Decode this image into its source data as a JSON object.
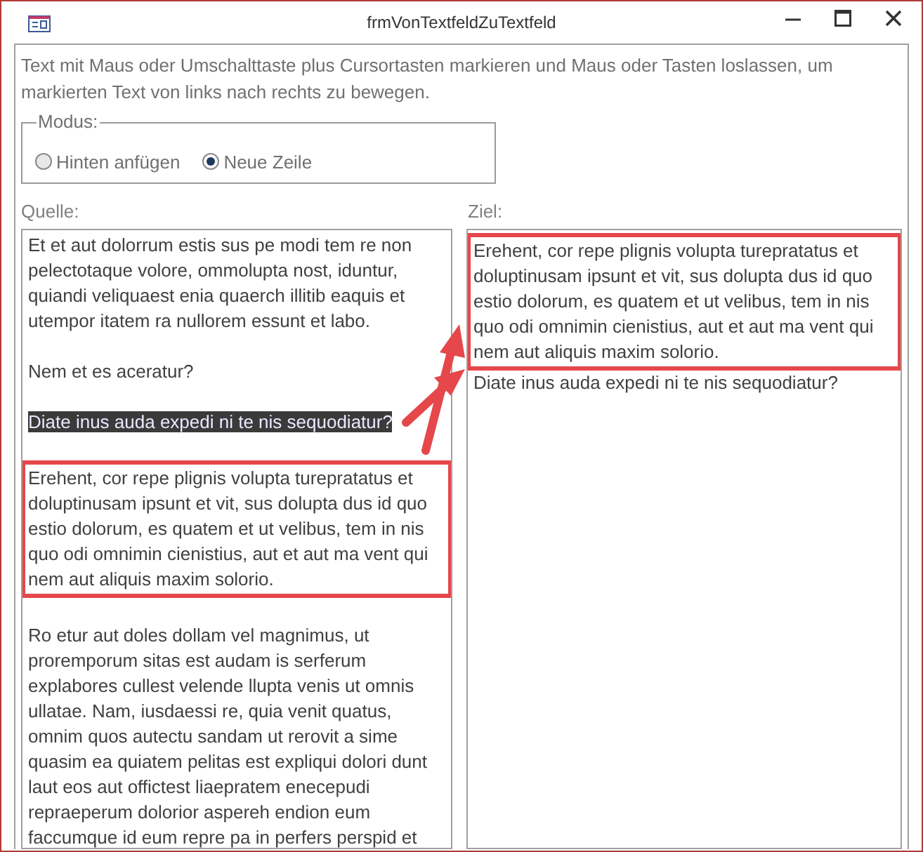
{
  "window": {
    "title": "frmVonTextfeldZuTextfeld"
  },
  "instruction": "Text mit Maus oder Umschalttaste plus Cursortasten markieren und Maus oder Tasten loslassen, um markierten Text von links nach rechts zu bewegen.",
  "modus": {
    "label": "Modus:",
    "options": [
      {
        "label": "Hinten anfügen",
        "selected": false
      },
      {
        "label": "Neue Zeile",
        "selected": true
      }
    ]
  },
  "source": {
    "label": "Quelle:",
    "paragraphs": [
      {
        "text": "Et et aut dolorrum estis sus pe modi tem re non pelectotaque volore, ommolupta nost, iduntur, quiandi veliquaest enia quaerch illitib eaquis et utempor itatem ra nullorem essunt et labo.",
        "selected": false,
        "framed": false
      },
      {
        "text": "Nem et es aceratur?",
        "selected": false,
        "framed": false
      },
      {
        "text": "Diate inus auda expedi ni te nis sequodiatur?",
        "selected": true,
        "framed": false
      },
      {
        "text": "Erehent, cor repe plignis volupta turepratatus et doluptinusam ipsunt et vit, sus dolupta dus id quo estio dolorum, es quatem et ut velibus, tem in nis quo odi omnimin cienistius, aut et aut ma vent qui nem aut aliquis maxim solorio.",
        "selected": false,
        "framed": true
      },
      {
        "text": "Ro etur aut doles dollam vel magnimus, ut proremporum sitas est audam is serferum explabores cullest velende llupta venis ut omnis ullatae. Nam, iusdaessi re, quia venit quatus, omnim quos autectu sandam ut rerovit a sime quasim ea quiatem pelitas est expliqui dolori dunt laut eos aut offictest liaepratem enecepudi repraeperum dolorior aspereh endion eum faccumque id eum repre pa in perfers perspid et",
        "selected": false,
        "framed": false
      }
    ]
  },
  "target": {
    "label": "Ziel:",
    "paragraphs": [
      {
        "text": "Erehent, cor repe plignis volupta turepratatus et doluptinusam ipsunt et vit, sus dolupta dus id quo estio dolorum, es quatem et ut velibus, tem in nis quo odi omnimin cienistius, aut et aut ma vent qui nem aut aliquis maxim solorio.",
        "selected": false,
        "framed": true
      },
      {
        "text": "Diate inus auda expedi ni te nis sequodiatur?",
        "selected": false,
        "framed": false
      }
    ]
  }
}
